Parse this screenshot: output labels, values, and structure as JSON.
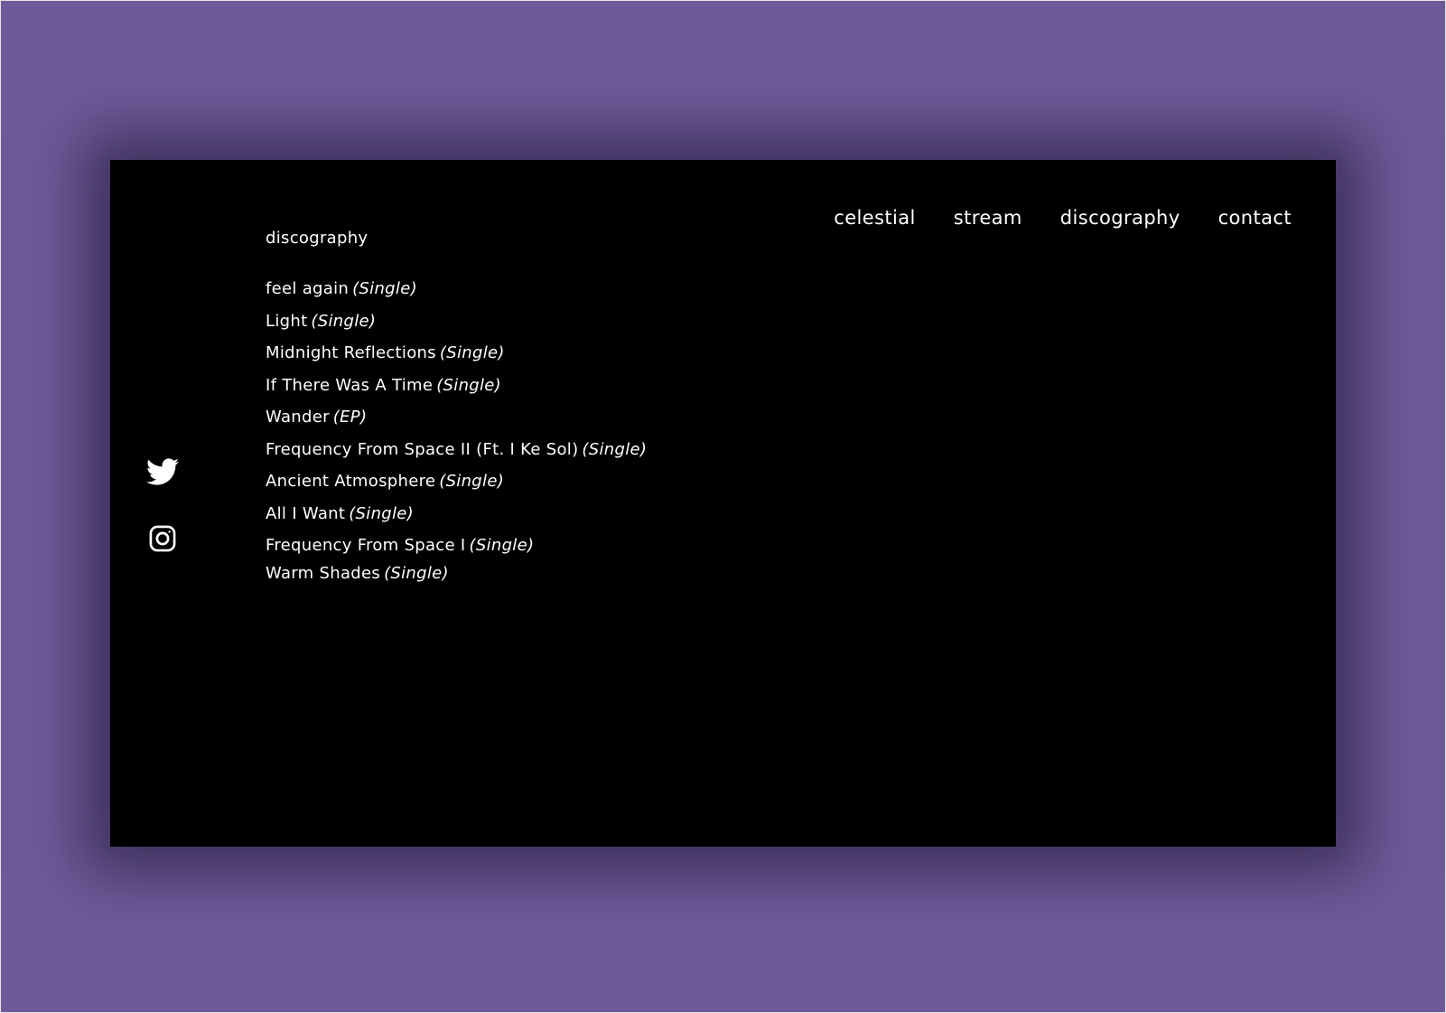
{
  "nav": {
    "items": [
      {
        "label": "celestial"
      },
      {
        "label": "stream"
      },
      {
        "label": "discography"
      },
      {
        "label": "contact"
      }
    ]
  },
  "page": {
    "title": "discography"
  },
  "releases": [
    {
      "title": "feel again",
      "type": "(Single)"
    },
    {
      "title": "Light",
      "type": "(Single)"
    },
    {
      "title": "Midnight Reflections",
      "type": "(Single)"
    },
    {
      "title": "If There Was A Time",
      "type": "(Single)"
    },
    {
      "title": "Wander",
      "type": "(EP)"
    },
    {
      "title": "Frequency From Space II (Ft. I Ke Sol)",
      "type": "(Single)"
    },
    {
      "title": "Ancient Atmosphere",
      "type": "(Single)"
    },
    {
      "title": "All I Want",
      "type": "(Single)"
    },
    {
      "title": "Frequency From Space I",
      "type": "(Single)"
    },
    {
      "title": "Warm Shades",
      "type": "(Single)"
    }
  ],
  "social": {
    "icons": [
      "twitter-icon",
      "instagram-icon"
    ]
  },
  "colors": {
    "backdrop": "#6e5a98",
    "panel": "#000000",
    "text": "#ffffff"
  }
}
